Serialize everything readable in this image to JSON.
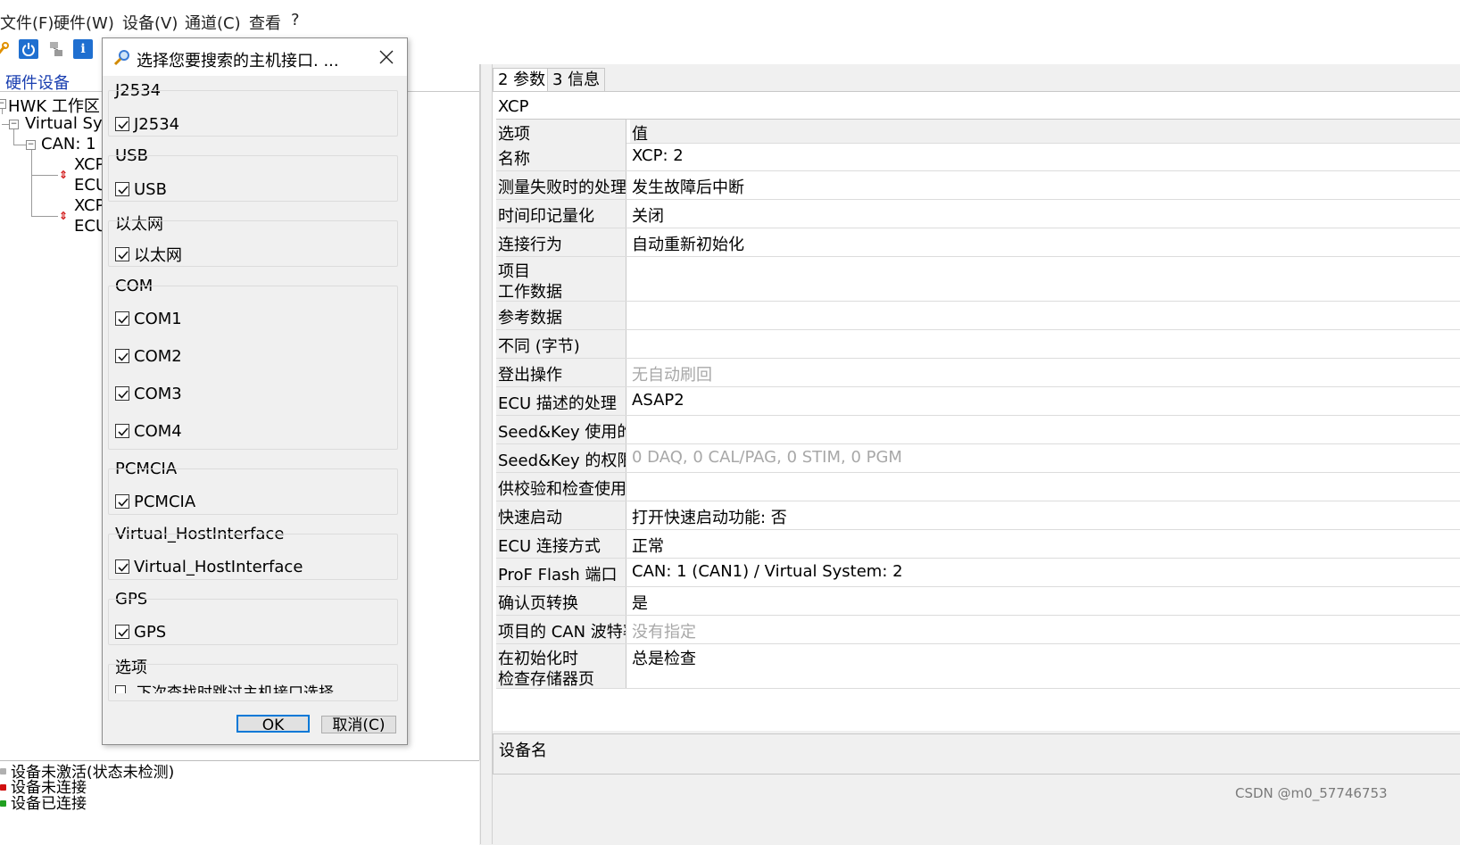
{
  "menubar": {
    "items": [
      "文件(F)",
      "硬件(W)",
      "设备(V)",
      "通道(C)",
      "查看",
      "?"
    ]
  },
  "left_panel": {
    "tab_label": "硬件设备",
    "tree": {
      "root": "HWK 工作区",
      "system": "Virtual Sys",
      "can": "CAN: 1",
      "items": [
        "XCP",
        "ECU",
        "XCP",
        "ECU"
      ]
    },
    "legend": [
      "设备未激活(状态未检测)",
      "设备未连接",
      "设备已连接"
    ]
  },
  "tabs": [
    "2 参数",
    "3 信息"
  ],
  "properties": {
    "heading": "XCP",
    "col_key": "选项",
    "col_val": "值",
    "rows": [
      {
        "key": "名称",
        "value": "XCP: 2"
      },
      {
        "key": "测量失败时的处理方",
        "value": "发生故障后中断"
      },
      {
        "key": "时间印记量化",
        "value": "关闭"
      },
      {
        "key": "连接行为",
        "value": "自动重新初始化"
      },
      {
        "key": "项目",
        "key2": "工作数据",
        "value": ""
      },
      {
        "key": "参考数据",
        "value": ""
      },
      {
        "key": "不同 (字节)",
        "value": ""
      },
      {
        "key": "登出操作",
        "value": "无自动刷回"
      },
      {
        "key": "ECU 描述的处理",
        "value": "ASAP2"
      },
      {
        "key": "Seed&Key 使用的",
        "value": ""
      },
      {
        "key": "Seed&Key 的权限",
        "value": "0 DAQ, 0 CAL/PAG, 0 STIM, 0 PGM"
      },
      {
        "key": "供校验和检查使用的",
        "value": ""
      },
      {
        "key": "快速启动",
        "value": "打开快速启动功能: 否"
      },
      {
        "key": "ECU 连接方式",
        "value": "正常"
      },
      {
        "key": "ProF Flash 端口",
        "value": "CAN: 1 (CAN1) / Virtual System: 2"
      },
      {
        "key": "确认页转换",
        "value": "是"
      },
      {
        "key": "项目的 CAN 波特率",
        "value": "没有指定"
      },
      {
        "key": "在初始化时",
        "key2": "检查存储器页",
        "value": "总是检查"
      }
    ]
  },
  "device_name_label": "设备名",
  "watermark": "CSDN @m0_57746753",
  "dialog": {
    "title": "选择您要搜索的主机接口. ...",
    "groups": [
      {
        "label": "J2534",
        "options": [
          "J2534"
        ]
      },
      {
        "label": "USB",
        "options": [
          "USB"
        ]
      },
      {
        "label": "以太网",
        "options": [
          "以太网"
        ]
      },
      {
        "label": "COM",
        "options": [
          "COM1",
          "COM2",
          "COM3",
          "COM4"
        ]
      },
      {
        "label": "PCMCIA",
        "options": [
          "PCMCIA"
        ]
      },
      {
        "label": "Virtual_HostInterface",
        "options": [
          "Virtual_HostInterface"
        ]
      },
      {
        "label": "GPS",
        "options": [
          "GPS"
        ]
      }
    ],
    "options_group": {
      "label": "选项",
      "checkbox": "下次查找时跳过主机接口选择"
    },
    "ok_label": "OK",
    "cancel_label": "取消(C)"
  }
}
